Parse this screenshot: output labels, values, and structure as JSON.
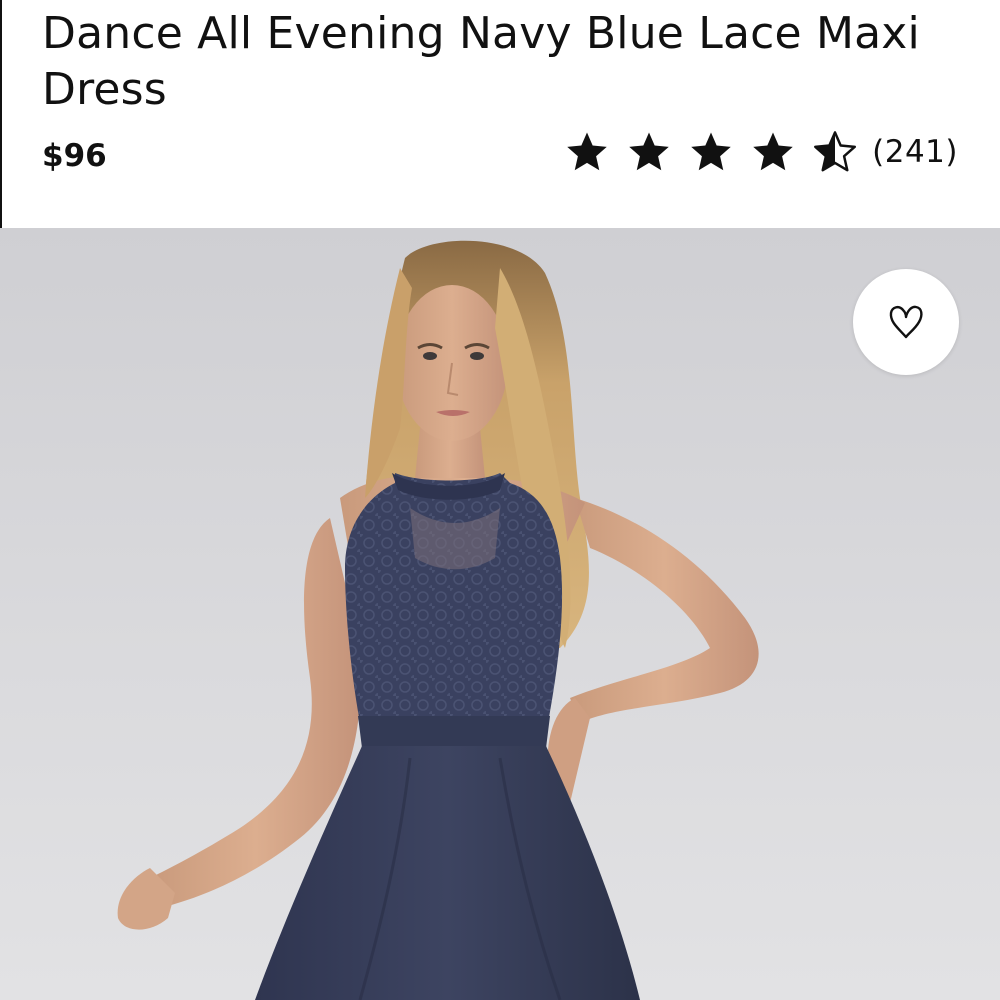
{
  "product": {
    "title": "Dance All Evening Navy Blue Lace Maxi Dress",
    "price": "$96",
    "rating": {
      "value": 4.5,
      "max": 5,
      "review_count_label": "(241)"
    }
  },
  "image": {
    "description_name": "model-wearing-navy-lace-maxi-dress"
  },
  "wishlist": {
    "icon": "heart-icon"
  },
  "colors": {
    "text": "#111111",
    "dress": "#39405a",
    "background": "#dcdcdf"
  }
}
